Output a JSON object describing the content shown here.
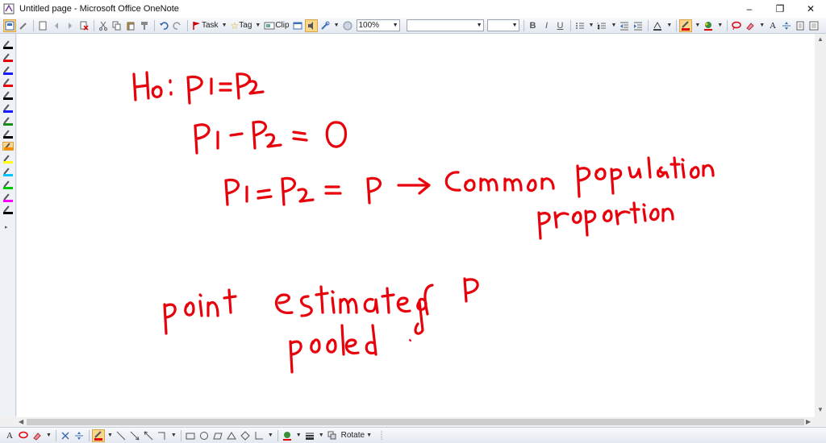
{
  "window": {
    "title": "Untitled page - Microsoft Office OneNote",
    "controls": {
      "minimize": "–",
      "maximize": "❐",
      "close": "✕"
    }
  },
  "toolbar": {
    "task_label": "Task",
    "tag_label": "Tag",
    "clip_label": "Clip",
    "zoom_value": "100%",
    "font_value": "",
    "size_value": "",
    "bold_label": "B",
    "italic_label": "I",
    "underline_label": "U",
    "ax_label": "A"
  },
  "bottombar": {
    "rotate_label": "Rotate",
    "ax_label": "A"
  },
  "pen_palette": {
    "colors": [
      "#000000",
      "#e8000b",
      "#1a1aff",
      "#e8000b",
      "#000000",
      "#1a1aff",
      "#1a8c1a",
      "#000000",
      "#ff8c00",
      "#ffff00",
      "#00c8ff",
      "#00c800",
      "#ff00ff",
      "#000000"
    ]
  },
  "colors": {
    "ink": "#e8000b",
    "accent": "#f8d68c"
  }
}
